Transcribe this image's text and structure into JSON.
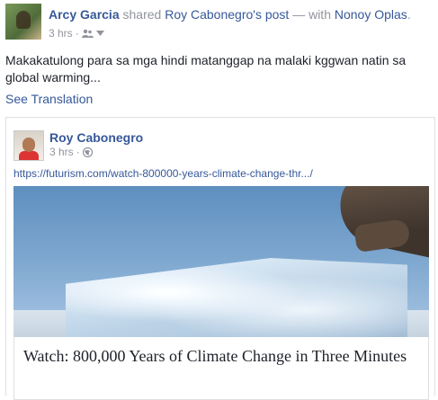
{
  "post": {
    "author": "Arcy Garcia",
    "action": "shared",
    "shared_from": "Roy Cabonegro's post",
    "with_prefix": "— with",
    "tagged": "Nonoy Oplas",
    "period": ".",
    "time": "3 hrs",
    "separator": "·",
    "body": "Makakatulong para sa mga hindi matanggap na malaki kggwan natin sa global warming...",
    "see_translation": "See Translation"
  },
  "shared_post": {
    "author": "Roy Cabonegro",
    "time": "3 hrs",
    "separator": "·",
    "url": "https://futurism.com/watch-800000-years-climate-change-thr.../",
    "preview_title": "Watch: 800,000 Years of Climate Change in Three Minutes"
  },
  "icons": {
    "audience": "friends-icon",
    "audience_menu": "chevron-down-icon",
    "shared_audience": "globe-icon"
  },
  "colors": {
    "link": "#365899",
    "muted": "#90949c",
    "text": "#1d2129",
    "border": "#dddfe2"
  }
}
